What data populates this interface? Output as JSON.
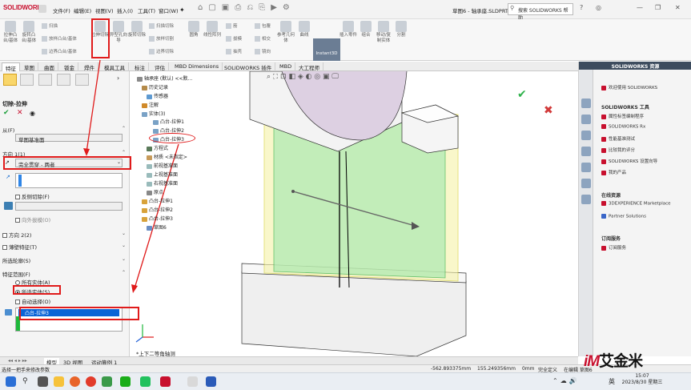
{
  "app": {
    "logo": "SOLIDWORKS",
    "doc_title": "草图6 - 轴承座.SLDPRT *",
    "search_placeholder": "搜索 SOLIDWORKS 帮助"
  },
  "menu": [
    "文件(F)",
    "编辑(E)",
    "视图(V)",
    "插入(I)",
    "工具(T)",
    "窗口(W)"
  ],
  "ribbon": {
    "big": [
      "拉伸凸台/基体",
      "旋转凸台/基体",
      "扫描",
      "放样凸台/基体",
      "边界凸台/基体",
      "拉伸切除",
      "异型孔向导",
      "旋转切除",
      "扫描切除",
      "放样切割",
      "边界切除",
      "圆角",
      "线性阵列",
      "筋",
      "包覆",
      "拔模",
      "相交",
      "抽壳",
      "镜向",
      "参考几何体",
      "曲线",
      "Instant3D",
      "插入零件",
      "组合",
      "移动/复制实体",
      "分割"
    ],
    "small": [
      "扫描",
      "放样凸台/基体",
      "边界凸台/基体",
      "扫描切除",
      "放样切割",
      "边界切除"
    ]
  },
  "tabs": [
    "特征",
    "草图",
    "曲面",
    "钣金",
    "焊件",
    "模具工具",
    "标注",
    "评估",
    "MBD Dimensions",
    "SOLIDWORKS 插件",
    "MBD",
    "大工程师"
  ],
  "pm": {
    "title": "切除-拉伸",
    "from_label": "从(F)",
    "from_value": "草图基准面",
    "dir1_label": "方向 1(1)",
    "end_condition": "完全贯穿 - 两者",
    "flip_label": "反侧切除(F)",
    "draft_label": "向外拔模(O)",
    "dir2_label": "方向 2(2)",
    "thin_label": "薄壁特征(T)",
    "contours_label": "所选轮廓(S)",
    "scope_label": "特征范围(F)",
    "all_bodies": "所有实体(A)",
    "selected_bodies": "所选实体(S)",
    "auto_select": "自动选择(O)",
    "selected_body_item": "凸台-拉伸3"
  },
  "tree": [
    "轴承座 (默认) <<默...",
    "历史记录",
    "传感器",
    "注解",
    "实体(3)",
    "凸台-拉伸1",
    "凸台-拉伸2",
    "凸台-拉伸3",
    "方程式",
    "材质 <未指定>",
    "前视基准面",
    "上视基准面",
    "右视基准面",
    "原点",
    "凸台-拉伸1",
    "凸台-拉伸2",
    "凸台-拉伸3",
    "草图6"
  ],
  "view_label": "*上下二等角轴测",
  "rpanel": {
    "header": "SOLIDWORKS 资源",
    "welcome": "欢迎使用 SOLIDWORKS",
    "tools_title": "SOLIDWORKS 工具",
    "tools": [
      "属性标签编制程序",
      "SOLIDWORKS Rx",
      "性能基准测试",
      "比较我的评分",
      "SOLIDWORKS 设置向导",
      "我的产品"
    ],
    "online_title": "在线资源",
    "online": [
      "3DEXPERIENCE Marketplace",
      "Partner Solutions"
    ],
    "sub_title": "订阅服务",
    "sub": [
      "订阅服务"
    ]
  },
  "bottom_tabs": [
    "模型",
    "3D 视图",
    "运动算例 1"
  ],
  "status": {
    "hint": "选择一把手来修改参数",
    "x": "-562.893375mm",
    "y": "155.249356mm",
    "z": "0mm",
    "state": "完全定义",
    "editing": "在编辑 草图6"
  },
  "clock": {
    "time": "15:07",
    "date": "2023/8/30 星期三",
    "lang": "英"
  },
  "brand": {
    "im": "iM",
    "name": "艾金米"
  },
  "colors": {
    "accent": "#c8102e",
    "highlight": "#e01b1b",
    "sel": "#0a64d6",
    "model": "#f5f5f5",
    "green": "#7fdc8f",
    "yellow": "#f1ee7a"
  }
}
